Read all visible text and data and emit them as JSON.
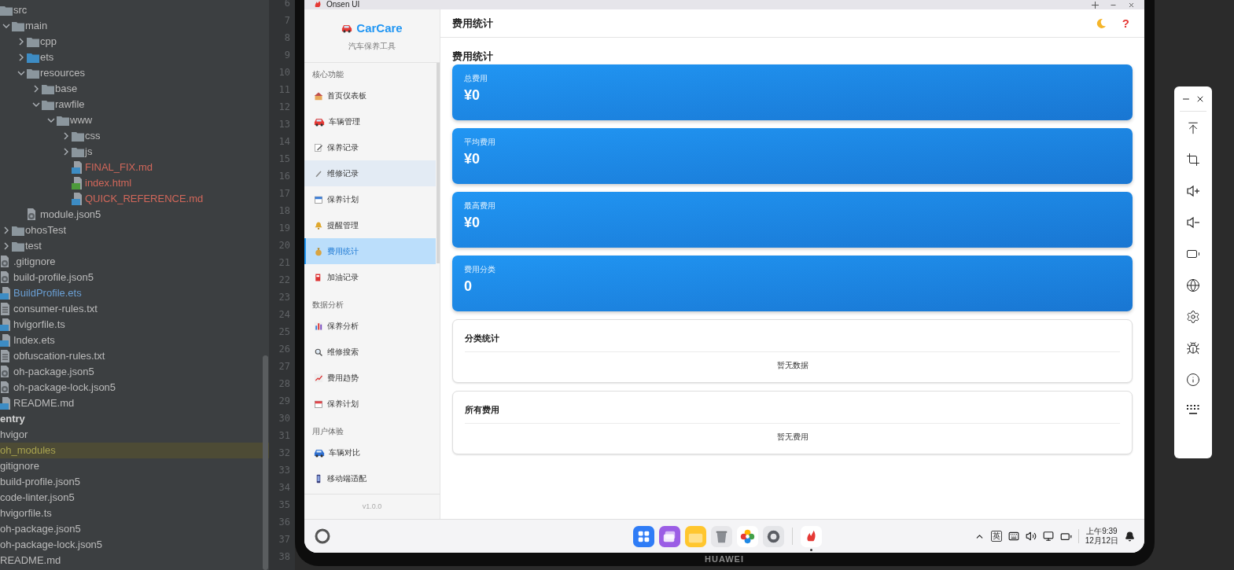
{
  "ide": {
    "tree": {
      "module_items": [
        {
          "label": "src",
          "kind": "folder",
          "children": [
            {
              "label": "main",
              "kind": "folder",
              "expanded": true,
              "children": [
                {
                  "label": "cpp",
                  "kind": "folder",
                  "expanded": false
                },
                {
                  "label": "ets",
                  "kind": "source_folder",
                  "expanded": false
                },
                {
                  "label": "resources",
                  "kind": "folder",
                  "expanded": true,
                  "children": [
                    {
                      "label": "base",
                      "kind": "folder",
                      "expanded": false
                    },
                    {
                      "label": "rawfile",
                      "kind": "folder",
                      "expanded": true,
                      "children": [
                        {
                          "label": "www",
                          "kind": "folder",
                          "expanded": true,
                          "children": [
                            {
                              "label": "css",
                              "kind": "folder",
                              "expanded": false
                            },
                            {
                              "label": "js",
                              "kind": "folder",
                              "expanded": false
                            },
                            {
                              "label": "FINAL_FIX.md",
                              "kind": "md",
                              "color": "#d1675a"
                            },
                            {
                              "label": "index.html",
                              "kind": "html",
                              "color": "#d1675a"
                            },
                            {
                              "label": "QUICK_REFERENCE.md",
                              "kind": "md",
                              "color": "#d1675a"
                            }
                          ]
                        }
                      ]
                    }
                  ]
                },
                {
                  "label": "module.json5",
                  "kind": "json"
                }
              ]
            },
            {
              "label": "ohosTest",
              "kind": "folder",
              "expanded": false
            },
            {
              "label": "test",
              "kind": "folder",
              "expanded": false
            }
          ]
        },
        {
          "label": ".gitignore",
          "kind": "ignore"
        },
        {
          "label": "build-profile.json5",
          "kind": "json"
        },
        {
          "label": "BuildProfile.ets",
          "kind": "ets",
          "color": "#6a9fd4"
        },
        {
          "label": "consumer-rules.txt",
          "kind": "txt"
        },
        {
          "label": "hvigorfile.ts",
          "kind": "ts"
        },
        {
          "label": "Index.ets",
          "kind": "ets"
        },
        {
          "label": "obfuscation-rules.txt",
          "kind": "txt"
        },
        {
          "label": "oh-package.json5",
          "kind": "json"
        },
        {
          "label": "oh-package-lock.json5",
          "kind": "json"
        },
        {
          "label": "README.md",
          "kind": "md"
        }
      ],
      "project_items": [
        {
          "label": "entry",
          "kind": "module",
          "highlighted": false
        },
        {
          "label": "hvigor",
          "kind": "plain",
          "highlighted": false
        },
        {
          "label": "oh_modules",
          "kind": "plain",
          "highlighted": true,
          "color": "#a8a34f"
        },
        {
          "label": "gitignore",
          "kind": "plain",
          "highlighted": false
        },
        {
          "label": "build-profile.json5",
          "kind": "plain",
          "highlighted": false
        },
        {
          "label": "code-linter.json5",
          "kind": "plain",
          "highlighted": false
        },
        {
          "label": "hvigorfile.ts",
          "kind": "plain",
          "highlighted": false
        },
        {
          "label": "oh-package.json5",
          "kind": "plain",
          "highlighted": false
        },
        {
          "label": "oh-package-lock.json5",
          "kind": "plain",
          "highlighted": false
        },
        {
          "label": "README.md",
          "kind": "plain",
          "highlighted": false
        }
      ]
    },
    "line_numbers": [
      "6",
      "7",
      "8",
      "9",
      "10",
      "11",
      "12",
      "13",
      "14",
      "15",
      "16",
      "17",
      "18",
      "19",
      "20",
      "21",
      "22",
      "23",
      "24",
      "25",
      "26",
      "27",
      "28",
      "29",
      "30",
      "31",
      "32",
      "33",
      "34",
      "35",
      "36",
      "37",
      "38"
    ]
  },
  "emulator": {
    "window_title": "Onsen UI",
    "brand": "HUAWEI",
    "app": {
      "sidebar": {
        "logo": "CarCare",
        "subtitle": "汽车保养工具",
        "version": "v1.0.0",
        "sections": [
          {
            "title": "核心功能",
            "items": [
              {
                "label": "首页仪表板",
                "selected": false,
                "hovered": false
              },
              {
                "label": "车辆管理",
                "selected": false,
                "hovered": false
              },
              {
                "label": "保养记录",
                "selected": false,
                "hovered": false
              },
              {
                "label": "维修记录",
                "selected": false,
                "hovered": true
              },
              {
                "label": "保养计划",
                "selected": false,
                "hovered": false
              },
              {
                "label": "提醒管理",
                "selected": false,
                "hovered": false
              },
              {
                "label": "费用统计",
                "selected": true,
                "hovered": false
              },
              {
                "label": "加油记录",
                "selected": false,
                "hovered": false
              }
            ]
          },
          {
            "title": "数据分析",
            "items": [
              {
                "label": "保养分析",
                "selected": false,
                "hovered": false
              },
              {
                "label": "维修搜索",
                "selected": false,
                "hovered": false
              },
              {
                "label": "费用趋势",
                "selected": false,
                "hovered": false
              },
              {
                "label": "保养计划",
                "selected": false,
                "hovered": false
              }
            ]
          },
          {
            "title": "用户体验",
            "items": [
              {
                "label": "车辆对比",
                "selected": false,
                "hovered": false
              },
              {
                "label": "移动端适配",
                "selected": false,
                "hovered": false
              }
            ]
          }
        ]
      },
      "header": {
        "title": "费用统计",
        "help_glyph": "?"
      },
      "page_title": "费用统计",
      "stats": [
        {
          "label": "总费用",
          "value": "¥0"
        },
        {
          "label": "平均费用",
          "value": "¥0"
        },
        {
          "label": "最高费用",
          "value": "¥0"
        },
        {
          "label": "费用分类",
          "value": "0"
        }
      ],
      "panels": [
        {
          "title": "分类统计",
          "empty_text": "暂无数据"
        },
        {
          "title": "所有费用",
          "empty_text": "暂无费用"
        }
      ]
    },
    "taskbar": {
      "ime": "英",
      "time": "上午9:39",
      "date": "12月12日",
      "dock": [
        {
          "running": false
        },
        {
          "running": false
        },
        {
          "running": false
        },
        {
          "running": false
        },
        {
          "running": false
        },
        {
          "running": false
        },
        {
          "running": true
        }
      ]
    }
  }
}
